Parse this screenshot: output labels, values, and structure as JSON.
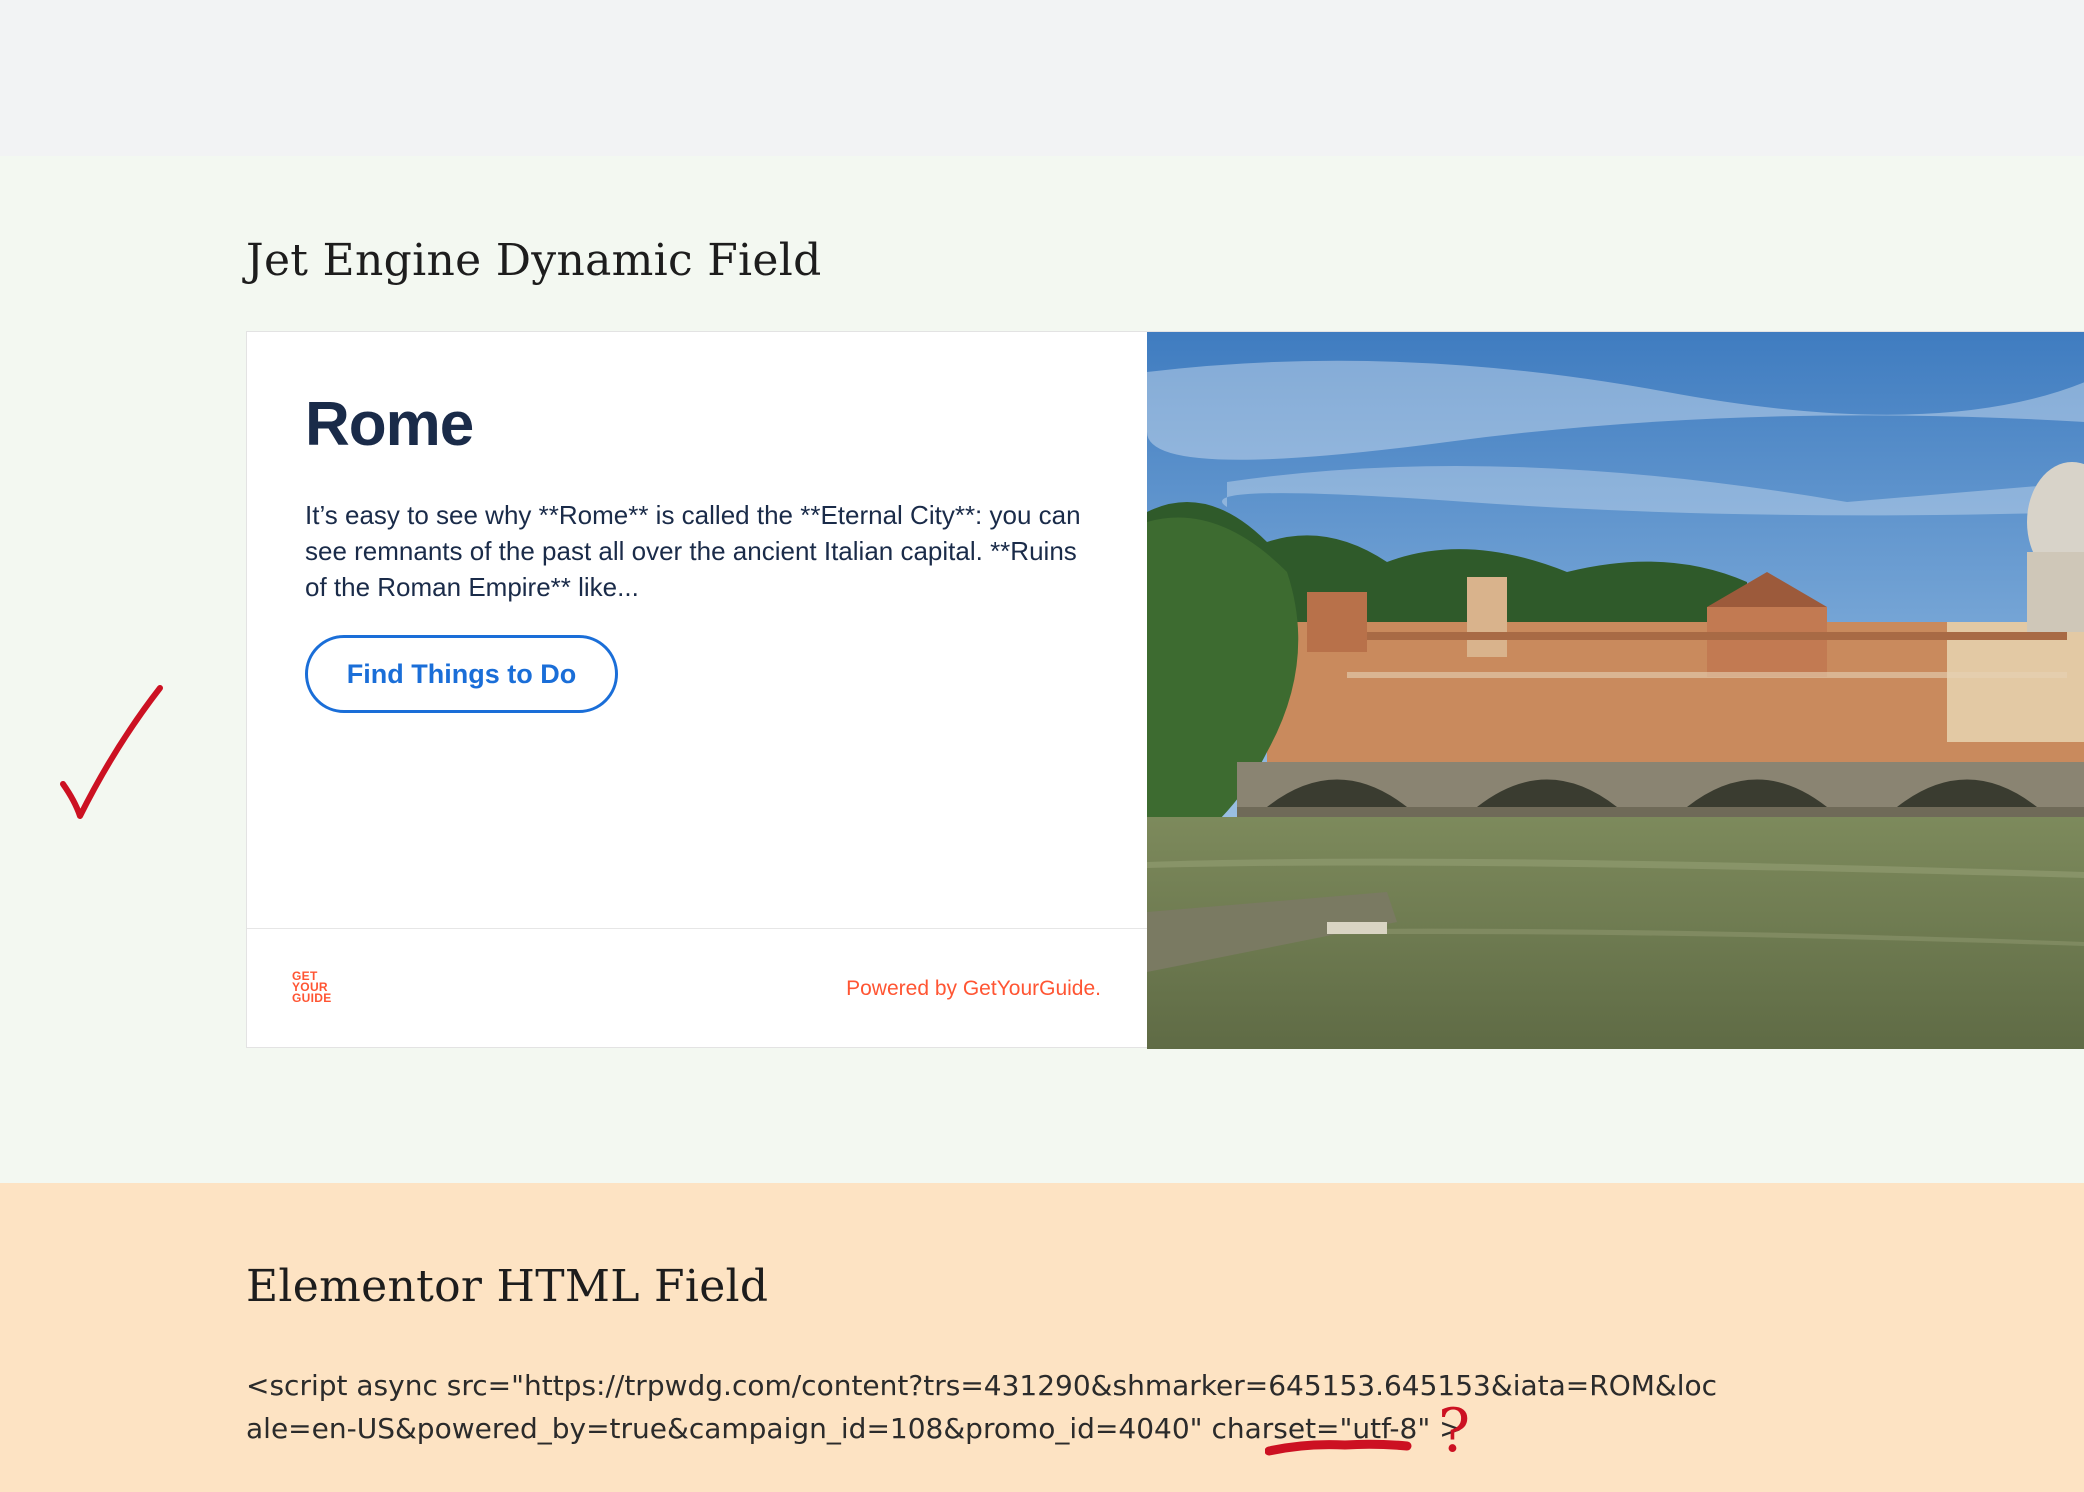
{
  "sections": {
    "jet": {
      "heading": "Jet Engine Dynamic Field",
      "widget": {
        "city": "Rome",
        "description": "It’s easy to see why **Rome** is called the **Eternal City**: you can see remnants of the past all over the ancient Italian capital. **Ruins of the Roman Empire** like...",
        "button_label": "Find Things to Do",
        "logo_lines": [
          "GET",
          "YOUR",
          "GUIDE"
        ],
        "powered_by": "Powered by GetYourGuide.",
        "photo_alt": "Rome skyline with bridge over the Tiber river"
      }
    },
    "elementor": {
      "heading": "Elementor HTML Field",
      "code": "<script async src=\"https://trpwdg.com/content?trs=431290&shmarker=645153.645153&iata=ROM&locale=en-US&powered_by=true&campaign_id=108&promo_id=4040\" charset=\"utf-8\" >"
    }
  },
  "annotations": {
    "checkmark_color": "#cc1122",
    "question_mark": "?"
  },
  "colors": {
    "jet_bg": "#f3f8f1",
    "elementor_bg": "#fde3c3",
    "brand_orange": "#ff5533",
    "link_blue": "#1a6ed8",
    "title_navy": "#1a2b49"
  }
}
